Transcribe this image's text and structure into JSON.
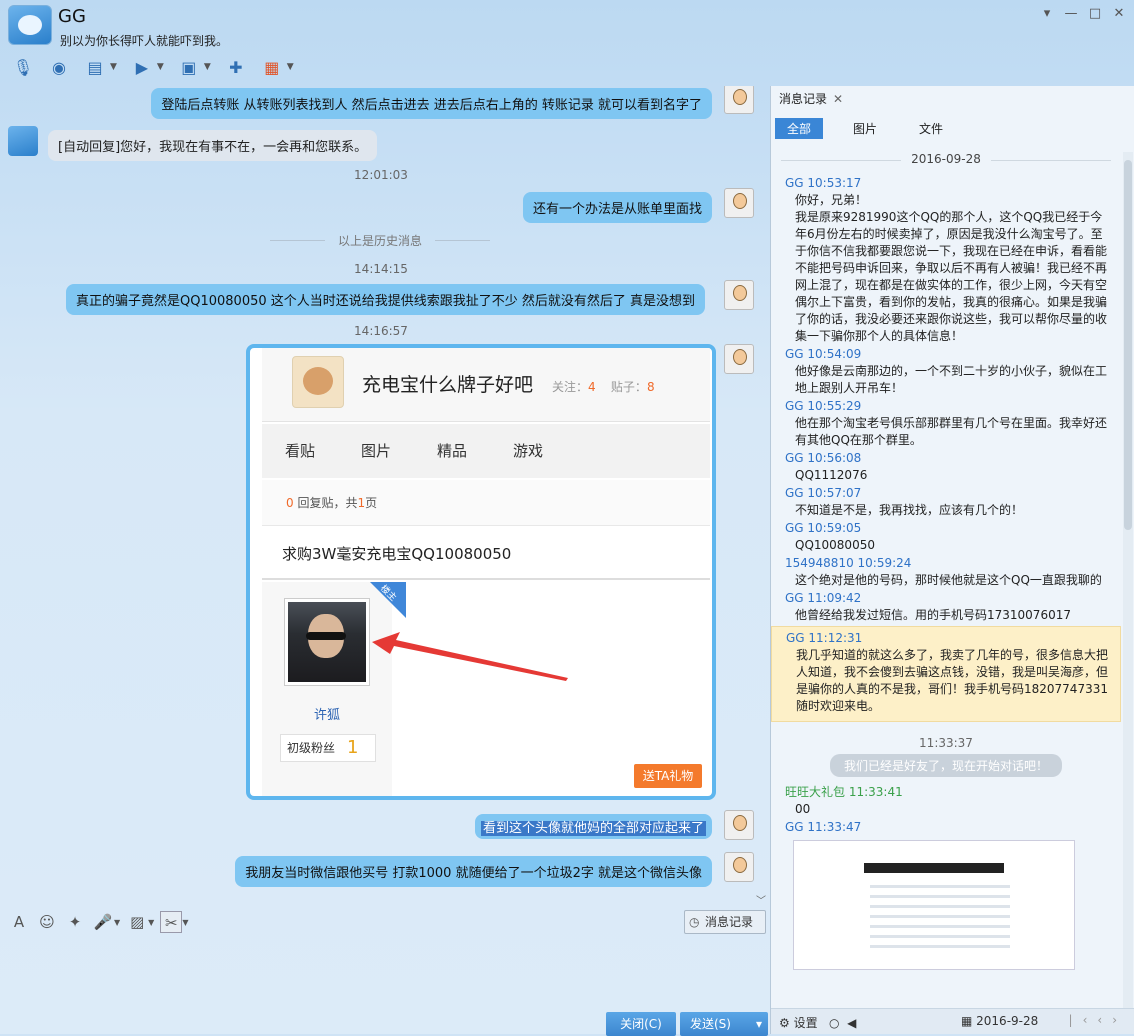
{
  "window": {
    "contact_name": "GG",
    "signature": "别以为你长得吓人就能吓到我。",
    "controls": [
      "▾",
      "—",
      "□",
      "✕"
    ]
  },
  "toolbar": {
    "icons": [
      "microphone-icon",
      "video-icon",
      "screen-share-icon",
      "file-transfer-icon",
      "remote-assist-icon",
      "message-add-icon",
      "apps-icon"
    ]
  },
  "chat": {
    "msg1": "登陆后点转账 从转账列表找到人 然后点击进去  进去后点右上角的 转账记录 就可以看到名字了",
    "auto_reply": "[自动回复]您好，我现在有事不在，一会再和您联系。",
    "time1": "12:01:03",
    "msg2": "还有一个办法是从账单里面找",
    "history_divider": "以上是历史消息",
    "time2": "14:14:15",
    "msg3": "真正的骗子竟然是QQ10080050   这个人当时还说给我提供线索跟我扯了不少 然后就没有然后了  真是没想到",
    "time3": "14:16:57",
    "msg4": "看到这个头像就他妈的全部对应起来了",
    "msg5": "我朋友当时微信跟他买号 打款1000 就随便给了一个垃圾2字  就是这个微信头像"
  },
  "card": {
    "title": "充电宝什么牌子好吧",
    "follow_label": "关注：",
    "follow_count": "4",
    "posts_label": "贴子：",
    "posts_count": "8",
    "nav": [
      "看贴",
      "图片",
      "精品",
      "游戏"
    ],
    "reply_count": "0",
    "reply_text": " 回复贴，共",
    "page_count": "1",
    "page_suffix": "页",
    "post_title": "求购3W毫安充电宝QQ10080050",
    "ribbon": "楼主",
    "poster_name": "许狐",
    "fan_level": "初级粉丝",
    "fan_badge": "1",
    "gift_button": "送TA礼物"
  },
  "input_toolbar": {
    "history_button": "消息记录"
  },
  "buttons": {
    "close": "关闭(C)",
    "send": "发送(S)"
  },
  "panel": {
    "tab_title": "消息记录",
    "filters": [
      "全部",
      "图片",
      "文件"
    ],
    "date": "2016-09-28",
    "messages": [
      {
        "h": "GG 10:53:17",
        "t": "你好，兄弟！\n我是原来9281990这个QQ的那个人，这个QQ我已经于今年6月份左右的时候卖掉了，原因是我没什么淘宝号了。至于你信不信我都要跟您说一下，我现在已经在申诉，看看能不能把号码申诉回来，争取以后不再有人被骗！我已经不再网上混了，现在都是在做实体的工作，很少上网，今天有空偶尔上下富贵，看到你的发帖，我真的很痛心。如果是我骗了你的话，我没必要还来跟你说这些，我可以帮你尽量的收集一下骗你那个人的具体信息！"
      },
      {
        "h": "GG 10:54:09",
        "t": "他好像是云南那边的，一个不到二十岁的小伙子，貌似在工地上跟别人开吊车！"
      },
      {
        "h": "GG 10:55:29",
        "t": "他在那个淘宝老号俱乐部那群里有几个号在里面。我幸好还有其他QQ在那个群里。"
      },
      {
        "h": "GG 10:56:08",
        "t": "QQ1112076"
      },
      {
        "h": "GG 10:57:07",
        "t": "不知道是不是，我再找找，应该有几个的！"
      },
      {
        "h": "GG 10:59:05",
        "t": "QQ10080050"
      },
      {
        "h": "154948810 10:59:24",
        "t": "这个绝对是他的号码，那时候他就是这个QQ一直跟我聊的"
      },
      {
        "h": "GG 11:09:42",
        "t": "他曾经给我发过短信。用的手机号码17310076017"
      }
    ],
    "highlight": {
      "h": "GG 11:12:31",
      "t": "我几乎知道的就这么多了，我卖了几年的号，很多信息大把人知道，我不会傻到去骗这点钱，没错，我是叫吴海彦，但是骗你的人真的不是我，哥们！我手机号码18207747331  随时欢迎来电。"
    },
    "time_after": "11:33:37",
    "friend_notice": "我们已经是好友了，现在开始对话吧！",
    "wangwang": {
      "h": "旺旺大礼包 11:33:41",
      "t": "00"
    },
    "last_header": "GG 11:33:47",
    "bottom_settings": "设置",
    "bottom_date": "2016-9-28"
  }
}
